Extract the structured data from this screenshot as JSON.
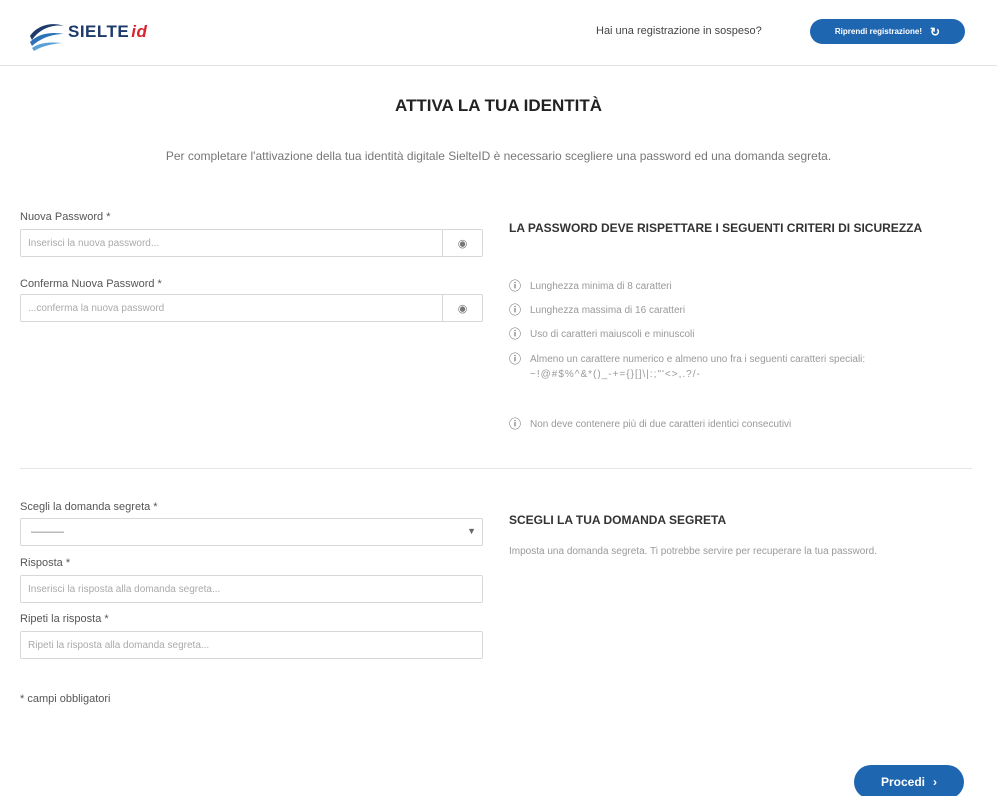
{
  "header": {
    "logo_text": "SIELTE",
    "logo_suffix": "id",
    "pending_question": "Hai una registrazione in sospeso?",
    "resume_label": "Riprendi registrazione!"
  },
  "page": {
    "title": "ATTIVA LA TUA IDENTITÀ",
    "intro": "Per completare l'attivazione della tua identità digitale SielteID è necessario scegliere una password ed una domanda segreta."
  },
  "password_form": {
    "new_password_label": "Nuova Password *",
    "new_password_placeholder": "Inserisci la nuova password...",
    "confirm_password_label": "Conferma Nuova Password *",
    "confirm_password_placeholder": "...conferma la nuova password"
  },
  "criteria": {
    "title": "LA PASSWORD DEVE RISPETTARE I SEGUENTI CRITERI DI SICUREZZA",
    "items": [
      "Lunghezza minima di 8 caratteri",
      "Lunghezza massima di 16 caratteri",
      "Uso di caratteri maiuscoli e minuscoli",
      "Almeno un carattere numerico e almeno uno fra i seguenti caratteri speciali:",
      "Non deve contenere più di due caratteri identici consecutivi"
    ],
    "special_chars": "~!@#$%^&*()_-+={}[]\\|:;\"'<>,.?/-"
  },
  "secret_form": {
    "question_label": "Scegli la domanda segreta *",
    "question_selected": "———",
    "answer_label": "Risposta *",
    "answer_placeholder": "Inserisci la risposta alla domanda segreta...",
    "repeat_label": "Ripeti la risposta *",
    "repeat_placeholder": "Ripeti la risposta alla domanda segreta..."
  },
  "secret_info": {
    "title": "SCEGLI LA TUA DOMANDA SEGRETA",
    "description": "Imposta una domanda segreta. Ti potrebbe servire per recuperare la tua password."
  },
  "footer": {
    "required_note": "* campi obbligatori",
    "proceed_label": "Procedi"
  },
  "colors": {
    "accent": "#1e67b0",
    "brand_dark": "#1d3a6b",
    "brand_red": "#d9232d"
  },
  "icons": {
    "eye": "eye-icon",
    "info": "info-circle-icon",
    "chevron": "chevron-down-icon",
    "reload": "reload-icon",
    "arrow": "chevron-right-icon"
  }
}
